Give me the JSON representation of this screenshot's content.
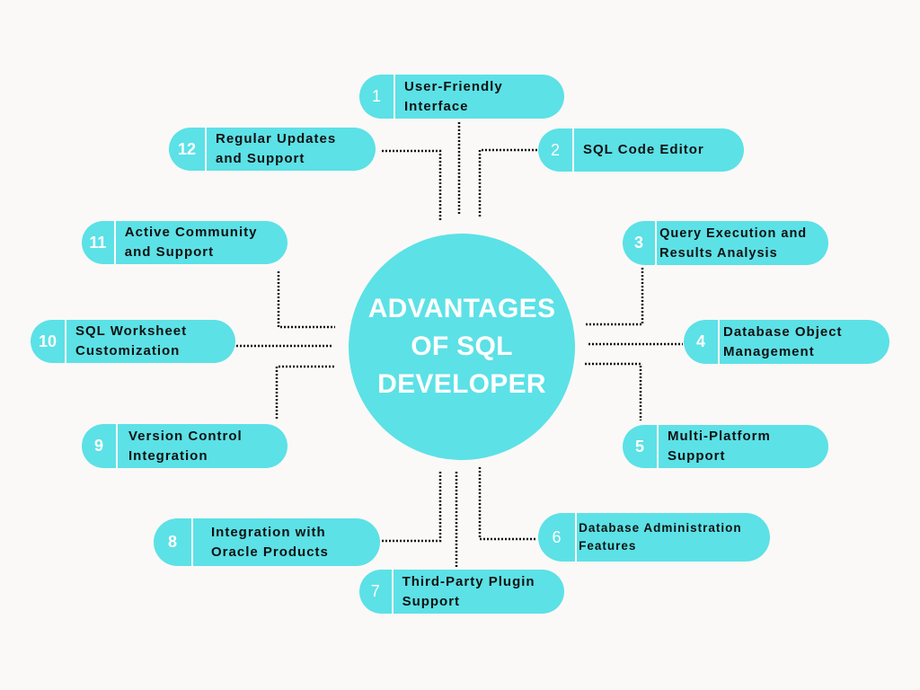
{
  "title": "ADVANTAGES OF SQL DEVELOPER",
  "colors": {
    "accent": "#5ce1e6",
    "background": "#faf9f7",
    "text": "#111111",
    "number": "#ffffff"
  },
  "items": [
    {
      "number": "1",
      "label": "User-Friendly Interface"
    },
    {
      "number": "2",
      "label": "SQL Code Editor"
    },
    {
      "number": "3",
      "label": "Query Execution and Results Analysis"
    },
    {
      "number": "4",
      "label": "Database Object Management"
    },
    {
      "number": "5",
      "label": "Multi-Platform Support"
    },
    {
      "number": "6",
      "label": "Database Administration Features"
    },
    {
      "number": "7",
      "label": "Third-Party Plugin Support"
    },
    {
      "number": "8",
      "label": "Integration with Oracle Products"
    },
    {
      "number": "9",
      "label": "Version Control Integration"
    },
    {
      "number": "10",
      "label": "SQL Worksheet Customization"
    },
    {
      "number": "11",
      "label": "Active Community and Support"
    },
    {
      "number": "12",
      "label": "Regular Updates and Support"
    }
  ]
}
